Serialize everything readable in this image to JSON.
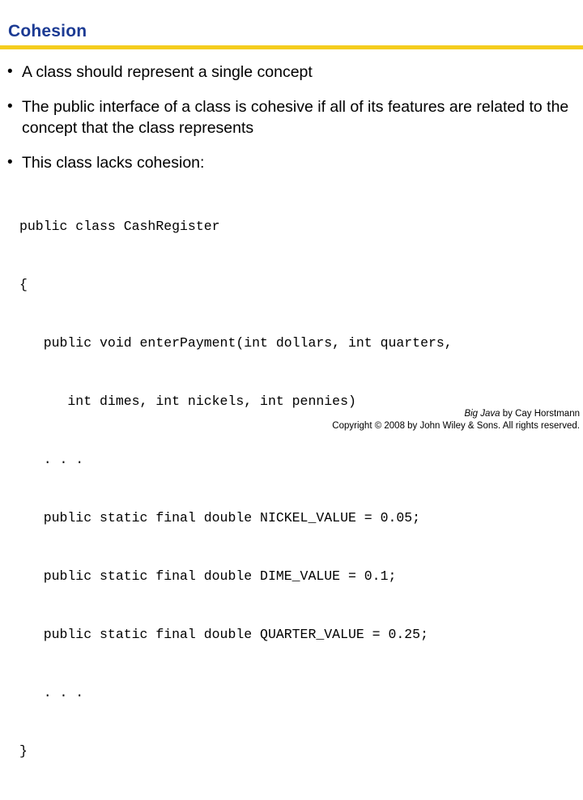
{
  "slide": {
    "title": "Cohesion",
    "accent_color": "#1b3a93",
    "rule_color": "#f5cd1e",
    "bullet_glyph": "•",
    "bullets": [
      "A class should represent a single concept",
      "The public interface of a class is cohesive if all of its features are related to the concept that the class represents",
      "This class lacks cohesion:"
    ],
    "code_lines": [
      "public class CashRegister",
      "{",
      "   public void enterPayment(int dollars, int quarters,",
      "      int dimes, int nickels, int pennies)",
      "   . . .",
      "   public static final double NICKEL_VALUE = 0.05;",
      "   public static final double DIME_VALUE = 0.1;",
      "   public static final double QUARTER_VALUE = 0.25;",
      "   . . .",
      "}"
    ],
    "footer": {
      "book_title": "Big Java",
      "byline": " by Cay Horstmann",
      "copyright": "Copyright © 2008 by John Wiley & Sons.  All rights reserved."
    }
  }
}
